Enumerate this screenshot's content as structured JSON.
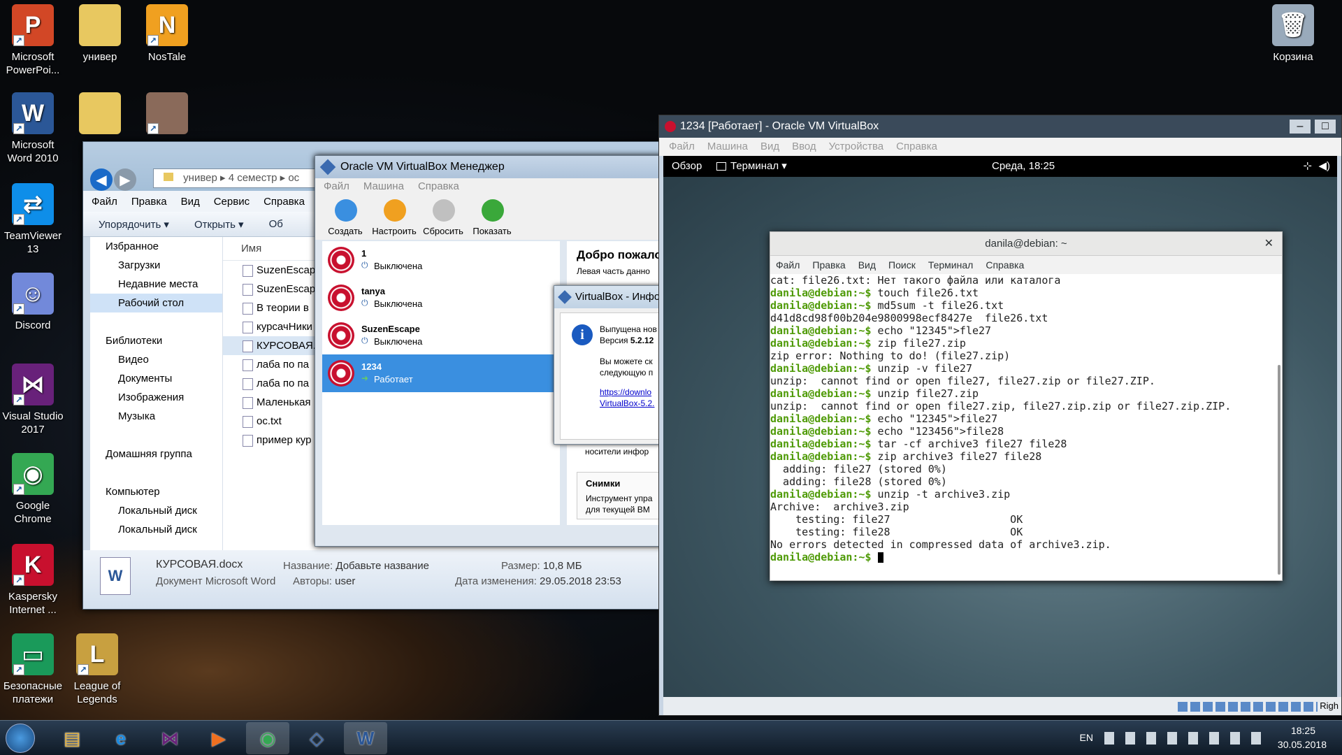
{
  "desktop": {
    "icons": [
      {
        "id": "ppt",
        "label": "Microsoft PowerPoi...",
        "icon": "powerpoint-icon",
        "color": "#d24726",
        "glyph": "P"
      },
      {
        "id": "univer1",
        "label": "универ",
        "icon": "folder-icon",
        "color": "#e8c860",
        "glyph": ""
      },
      {
        "id": "nostale",
        "label": "NosTale",
        "icon": "nostale-icon",
        "color": "#f0a020",
        "glyph": "N"
      },
      {
        "id": "word",
        "label": "Microsoft Word 2010",
        "icon": "word-icon",
        "color": "#2b5797",
        "glyph": "W"
      },
      {
        "id": "univer2",
        "label": "",
        "icon": "folder-icon",
        "color": "#e8c860",
        "glyph": ""
      },
      {
        "id": "portrait",
        "label": "",
        "icon": "portrait-icon",
        "color": "#8a6a5a",
        "glyph": ""
      },
      {
        "id": "teamviewer",
        "label": "TeamViewer 13",
        "icon": "teamviewer-icon",
        "color": "#0e8ee9",
        "glyph": "⇄"
      },
      {
        "id": "discord",
        "label": "Discord",
        "icon": "discord-icon",
        "color": "#7289da",
        "glyph": "☺"
      },
      {
        "id": "vs",
        "label": "Visual Studio 2017",
        "icon": "visual-studio-icon",
        "color": "#68217a",
        "glyph": "⋈"
      },
      {
        "id": "chrome",
        "label": "Google Chrome",
        "icon": "chrome-icon",
        "color": "#34a853",
        "glyph": "◉"
      },
      {
        "id": "kaspersky",
        "label": "Kaspersky Internet ...",
        "icon": "kaspersky-icon",
        "color": "#c8102e",
        "glyph": "K"
      },
      {
        "id": "safe",
        "label": "Безопасные платежи",
        "icon": "safe-payments-icon",
        "color": "#1a9a5a",
        "glyph": "▭"
      },
      {
        "id": "lol",
        "label": "League of Legends",
        "icon": "league-of-legends-icon",
        "color": "#c8a040",
        "glyph": "L"
      },
      {
        "id": "trash",
        "label": "Корзина",
        "icon": "recycle-bin-icon",
        "color": "#9ab",
        "glyph": "🗑"
      }
    ]
  },
  "explorer": {
    "address": [
      "универ",
      "4 семестр",
      "ос"
    ],
    "menu": [
      "Файл",
      "Правка",
      "Вид",
      "Сервис",
      "Справка"
    ],
    "toolbar": [
      "Упорядочить ▾",
      "Открыть ▾",
      "Об"
    ],
    "nav": [
      {
        "label": "Избранное",
        "sub": false,
        "sel": false
      },
      {
        "label": "Загрузки",
        "sub": true,
        "sel": false
      },
      {
        "label": "Недавние места",
        "sub": true,
        "sel": false
      },
      {
        "label": "Рабочий стол",
        "sub": true,
        "sel": true
      },
      {
        "label": "",
        "sub": false,
        "sel": false
      },
      {
        "label": "Библиотеки",
        "sub": false,
        "sel": false
      },
      {
        "label": "Видео",
        "sub": true,
        "sel": false
      },
      {
        "label": "Документы",
        "sub": true,
        "sel": false
      },
      {
        "label": "Изображения",
        "sub": true,
        "sel": false
      },
      {
        "label": "Музыка",
        "sub": true,
        "sel": false
      },
      {
        "label": "",
        "sub": false,
        "sel": false
      },
      {
        "label": "Домашняя группа",
        "sub": false,
        "sel": false
      },
      {
        "label": "",
        "sub": false,
        "sel": false
      },
      {
        "label": "Компьютер",
        "sub": false,
        "sel": false
      },
      {
        "label": "Локальный диск",
        "sub": true,
        "sel": false
      },
      {
        "label": "Локальный диск",
        "sub": true,
        "sel": false
      }
    ],
    "col_name": "Имя",
    "files": [
      {
        "name": "SuzenEscap",
        "sel": false
      },
      {
        "name": "SuzenEscap",
        "sel": false
      },
      {
        "name": "В теории в",
        "sel": false
      },
      {
        "name": "курсачНики",
        "sel": false
      },
      {
        "name": "КУРСОВАЯ.",
        "sel": true
      },
      {
        "name": "лаба по па",
        "sel": false
      },
      {
        "name": "лаба по па",
        "sel": false
      },
      {
        "name": "Маленькая",
        "sel": false
      },
      {
        "name": "ос.txt",
        "sel": false
      },
      {
        "name": "пример кур",
        "sel": false
      }
    ],
    "status": {
      "filename": "КУРСОВАЯ.docx",
      "filetype": "Документ Microsoft Word",
      "title_label": "Название:",
      "title_value": "Добавьте название",
      "authors_label": "Авторы:",
      "authors_value": "user",
      "size_label": "Размер:",
      "size_value": "10,8 МБ",
      "date_label": "Дата изменения:",
      "date_value": "29.05.2018 23:53"
    }
  },
  "vbmanager": {
    "title": "Oracle VM VirtualBox Менеджер",
    "menu": [
      "Файл",
      "Машина",
      "Справка"
    ],
    "tools": [
      {
        "label": "Создать",
        "color": "#3a8fe0"
      },
      {
        "label": "Настроить",
        "color": "#f0a020"
      },
      {
        "label": "Сбросить",
        "color": "#c0c0c0"
      },
      {
        "label": "Показать",
        "color": "#3aa83a"
      }
    ],
    "vms": [
      {
        "name": "1",
        "state": "Выключена",
        "sel": false
      },
      {
        "name": "tanya",
        "state": "Выключена",
        "sel": false
      },
      {
        "name": "SuzenEscape",
        "state": "Выключена",
        "sel": false
      },
      {
        "name": "1234",
        "state": "Работает",
        "sel": true
      }
    ],
    "welcome": "Добро пожало",
    "welcome_text1": "Левая часть данно",
    "welcome_text2": "",
    "snap_title": "Снимки",
    "snap_text1": "Инструмент упра",
    "snap_text2": "для текущей ВМ",
    "media_text": "носители инфор"
  },
  "dialog": {
    "title": "VirtualBox - Инфо",
    "line1": "Выпущена нов",
    "line2_label": "Версия",
    "line2_value": "5.2.12",
    "line3": "Вы можете ск",
    "line4": "следующую п",
    "link1": "https://downlo",
    "link2": "VirtualBox-5.2."
  },
  "vmwindow": {
    "title": "1234 [Работает] - Oracle VM VirtualBox",
    "menu": [
      "Файл",
      "Машина",
      "Вид",
      "Ввод",
      "Устройства",
      "Справка"
    ],
    "status_right": "Righ"
  },
  "gnome": {
    "activities": "Обзор",
    "app": "Терминал ▾",
    "clock": "Среда, 18:25"
  },
  "terminal": {
    "title": "danila@debian: ~",
    "menu": [
      "Файл",
      "Правка",
      "Вид",
      "Поиск",
      "Терминал",
      "Справка"
    ],
    "prompt": "danila@debian:~$",
    "lines": [
      {
        "p": false,
        "t": "cat: file26.txt: Нет такого файла или каталога"
      },
      {
        "p": true,
        "t": " touch file26.txt"
      },
      {
        "p": true,
        "t": " md5sum -t file26.txt"
      },
      {
        "p": false,
        "t": "d41d8cd98f00b204e9800998ecf8427e  file26.txt"
      },
      {
        "p": true,
        "t": " echo \"12345\">fle27"
      },
      {
        "p": true,
        "t": " zip file27.zip"
      },
      {
        "p": false,
        "t": ""
      },
      {
        "p": false,
        "t": "zip error: Nothing to do! (file27.zip)"
      },
      {
        "p": true,
        "t": " unzip -v file27"
      },
      {
        "p": false,
        "t": "unzip:  cannot find or open file27, file27.zip or file27.ZIP."
      },
      {
        "p": true,
        "t": " unzip file27.zip"
      },
      {
        "p": false,
        "t": "unzip:  cannot find or open file27.zip, file27.zip.zip or file27.zip.ZIP."
      },
      {
        "p": true,
        "t": " echo \"12345\">file27"
      },
      {
        "p": true,
        "t": " echo \"123456\">file28"
      },
      {
        "p": true,
        "t": " tar -cf archive3 file27 file28"
      },
      {
        "p": true,
        "t": " zip archive3 file27 file28"
      },
      {
        "p": false,
        "t": "  adding: file27 (stored 0%)"
      },
      {
        "p": false,
        "t": "  adding: file28 (stored 0%)"
      },
      {
        "p": true,
        "t": " unzip -t archive3.zip"
      },
      {
        "p": false,
        "t": "Archive:  archive3.zip"
      },
      {
        "p": false,
        "t": "    testing: file27                   OK"
      },
      {
        "p": false,
        "t": "    testing: file28                   OK"
      },
      {
        "p": false,
        "t": "No errors detected in compressed data of archive3.zip."
      },
      {
        "p": true,
        "t": " "
      }
    ]
  },
  "taskbar": {
    "apps": [
      {
        "icon": "explorer-icon",
        "color": "#e0b040",
        "glyph": "▤"
      },
      {
        "icon": "ie-icon",
        "color": "#1a8ae0",
        "glyph": "e"
      },
      {
        "icon": "visual-studio-icon",
        "color": "#68217a",
        "glyph": "⋈"
      },
      {
        "icon": "media-player-icon",
        "color": "#f07020",
        "glyph": "▶"
      },
      {
        "icon": "chrome-icon",
        "color": "#34a853",
        "glyph": "◉"
      },
      {
        "icon": "virtualbox-icon",
        "color": "#3a6ab0",
        "glyph": "◇"
      },
      {
        "icon": "word-icon",
        "color": "#2b5797",
        "glyph": "W"
      }
    ],
    "lang": "EN",
    "time": "18:25",
    "date": "30.05.2018"
  }
}
